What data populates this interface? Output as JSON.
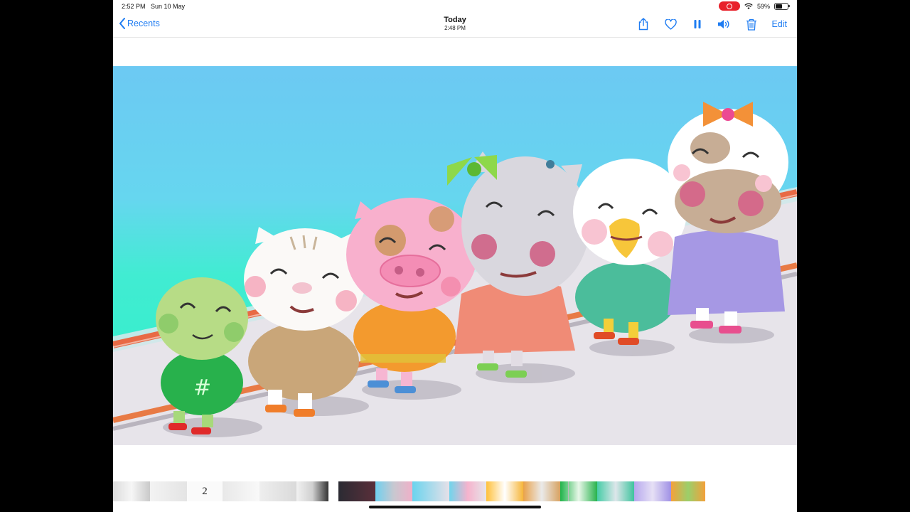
{
  "status": {
    "time": "2:52 PM",
    "date": "Sun 10 May",
    "battery": "59%",
    "battery_level": 0.59
  },
  "nav": {
    "back_label": "Recents",
    "title": "Today",
    "subtitle": "2:48 PM",
    "edit_label": "Edit"
  },
  "icons": {
    "share": "share-icon",
    "favorite": "heart-icon",
    "pause": "pause-icon",
    "volume": "speaker-icon",
    "delete": "trash-icon"
  },
  "strip": {
    "page_number": "2"
  },
  "colors": {
    "accent": "#1e7cf2",
    "record": "#e8212b",
    "sky": "#6fcdf4",
    "sea": "#3ee8cf"
  }
}
